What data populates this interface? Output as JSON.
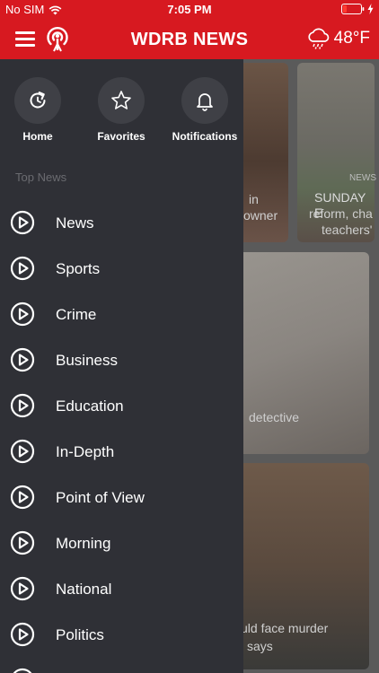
{
  "status_bar": {
    "carrier": "No SIM",
    "time": "7:05 PM"
  },
  "header": {
    "brand": "WDRB NEWS",
    "weather_temp": "48°F"
  },
  "quick_links": [
    {
      "label": "Home",
      "icon": "refresh-home-icon"
    },
    {
      "label": "Favorites",
      "icon": "star-icon"
    },
    {
      "label": "Notifications",
      "icon": "bell-icon"
    }
  ],
  "drawer": {
    "section_title": "Top News",
    "items": [
      "News",
      "Sports",
      "Crime",
      "Business",
      "Education",
      "In-Depth",
      "Point of View",
      "Morning",
      "National",
      "Politics"
    ]
  },
  "background": {
    "card1_line1": "in",
    "card1_line2": "owner",
    "card2_badge": "NEWS",
    "card2_line1": "SUNDAY E",
    "card2_line2": "reform, cha",
    "card2_line3": "teachers'",
    "card3_line1": "detective",
    "card4_line1": "uld face murder",
    "card4_line2": "says"
  },
  "colors": {
    "brand_red": "#d71920",
    "drawer_bg": "#2f3036"
  }
}
